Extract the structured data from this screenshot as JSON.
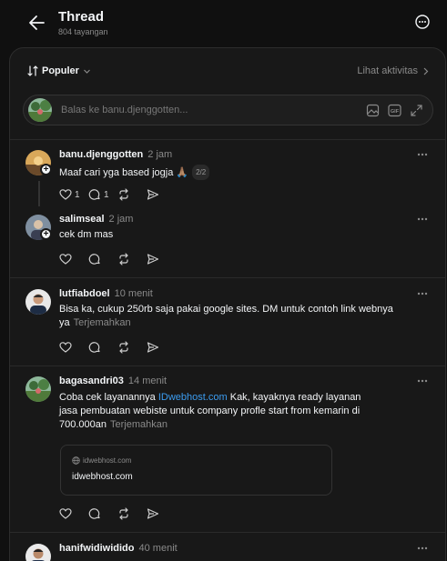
{
  "header": {
    "title": "Thread",
    "views": "804 tayangan"
  },
  "sortbar": {
    "sort_label": "Populer",
    "activity_label": "Lihat aktivitas"
  },
  "reply_box": {
    "placeholder": "Balas ke banu.djenggotten..."
  },
  "posts": [
    {
      "username": "banu.djenggotten",
      "time": "2 jam",
      "text": "Maaf cari yga based jogja 🙏🏽",
      "page_badge": "2/2",
      "likes": "1",
      "replies": "1"
    },
    {
      "username": "salimseal",
      "time": "2 jam",
      "text": "cek dm mas"
    },
    {
      "username": "lutfiabdoel",
      "time": "10 menit",
      "text": "Bisa ka, cukup 250rb saja pakai google sites. DM untuk contoh link webnya ya",
      "translate": "Terjemahkan"
    },
    {
      "username": "bagasandri03",
      "time": "14 menit",
      "text_before": "Coba cek layanannya ",
      "link": "IDwebhost.com",
      "text_after": " Kak, kayaknya ready layanan jasa pembuatan webiste untuk company profle start from kemarin di 700.000an",
      "translate": "Terjemahkan",
      "link_card": {
        "domain": "idwebhost.com",
        "title": "idwebhost.com"
      }
    },
    {
      "username": "hanifwidiwidido",
      "time": "40 menit",
      "text": ""
    }
  ],
  "colors": {
    "background": "#101010",
    "panel": "#181818",
    "link": "#3b9cf0",
    "muted": "#8a8a8a"
  }
}
